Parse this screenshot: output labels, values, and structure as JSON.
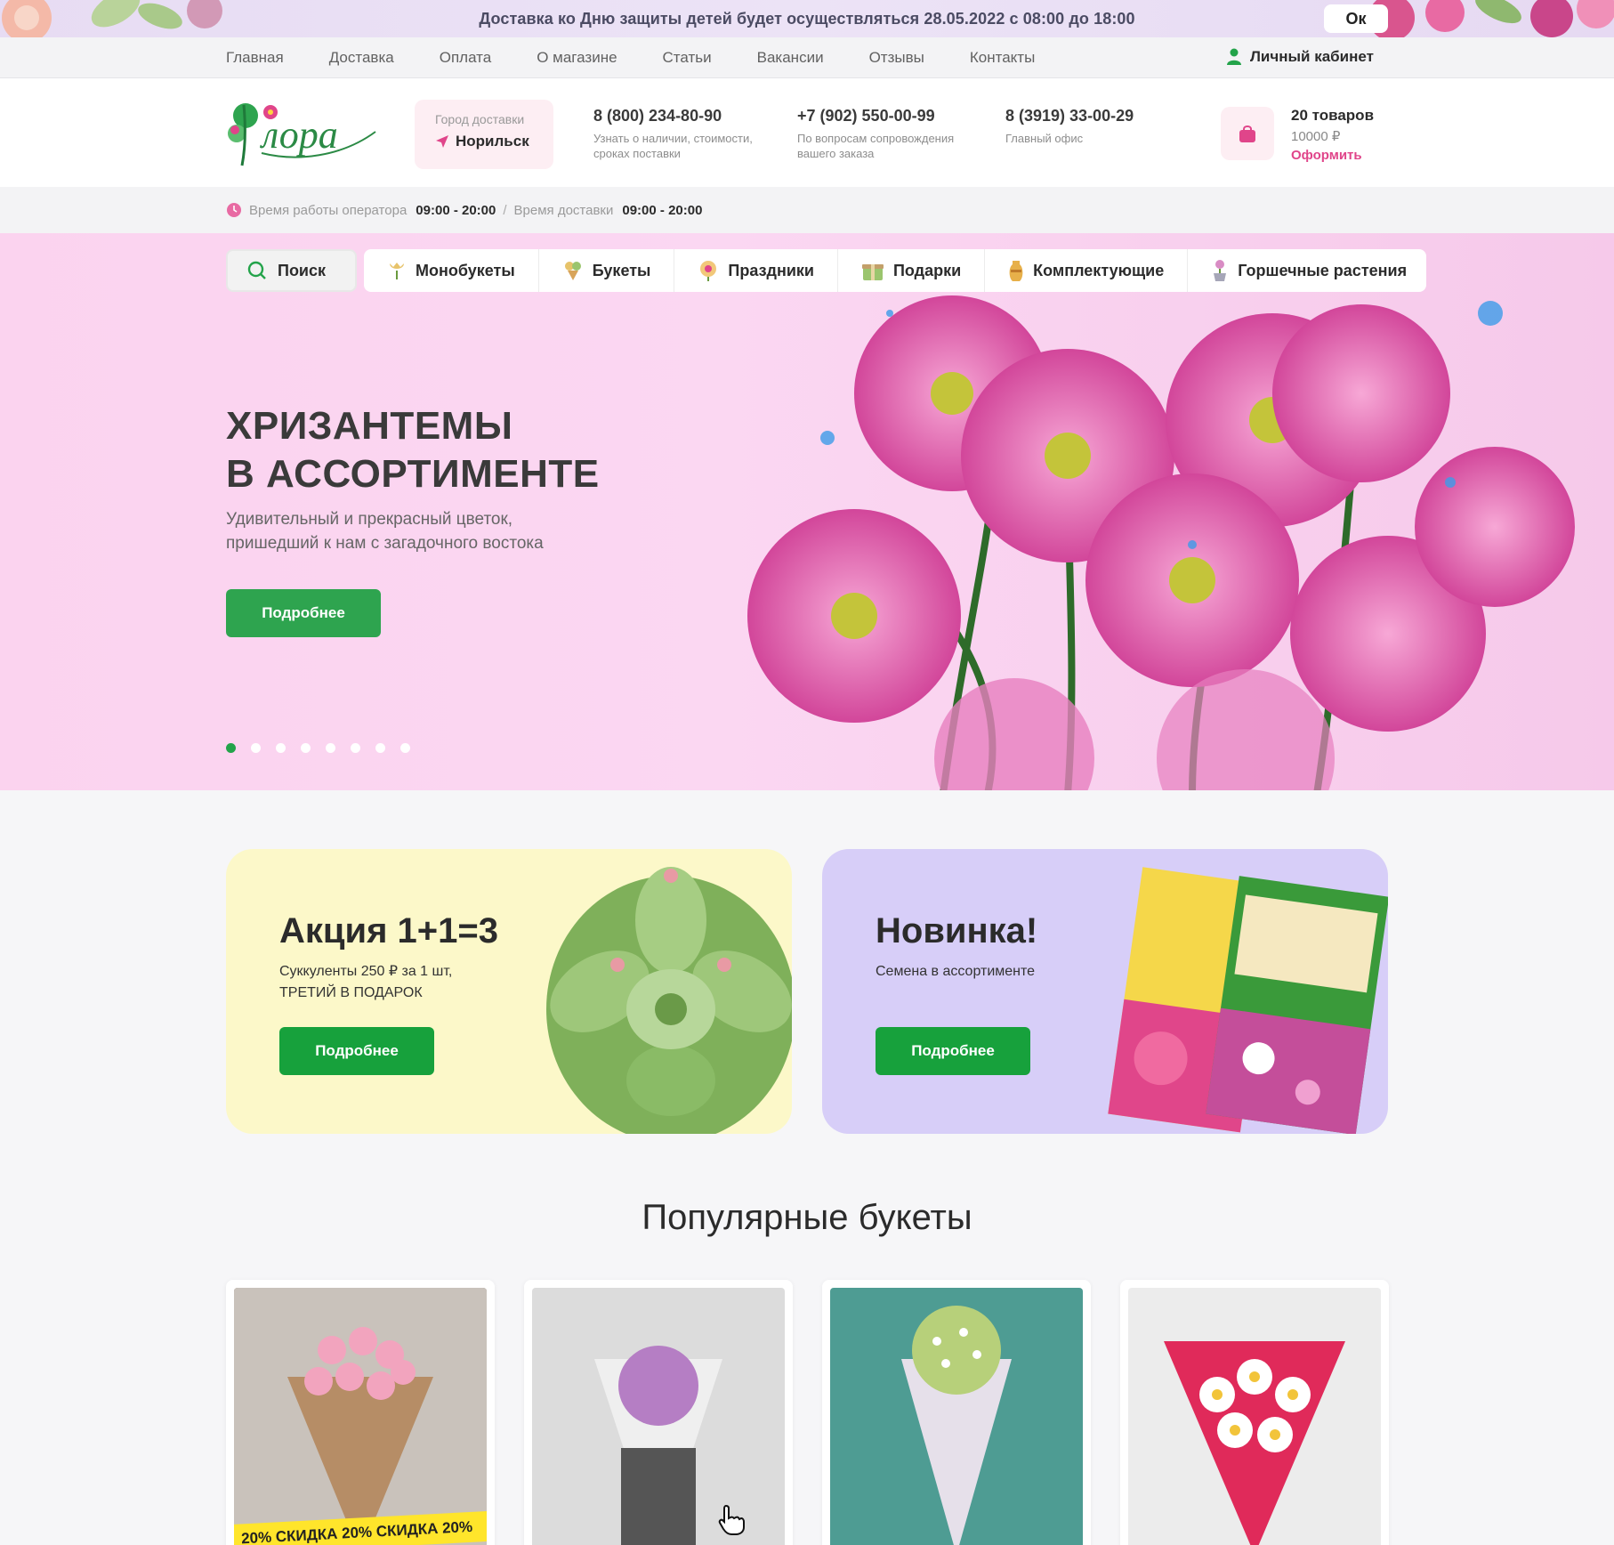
{
  "announcement": {
    "text": "Доставка ко Дню защиты детей будет осуществляться 28.05.2022 с 08:00 до 18:00",
    "ok_label": "Ок"
  },
  "topnav": {
    "items": [
      "Главная",
      "Доставка",
      "Оплата",
      "О магазине",
      "Статьи",
      "Вакансии",
      "Отзывы",
      "Контакты"
    ],
    "cabinet": "Личный кабинет"
  },
  "header": {
    "logo_text": "Флора",
    "city_label": "Город доставки",
    "city_value": "Норильск",
    "phones": [
      {
        "number": "8 (800) 234-80-90",
        "note": "Узнать о наличии, стоимости, сроках поставки"
      },
      {
        "number": "+7 (902) 550-00-99",
        "note": "По вопросам сопровождения вашего заказа"
      },
      {
        "number": "8 (3919) 33-00-29",
        "note": "Главный офис"
      }
    ],
    "cart": {
      "count": "20 товаров",
      "sum": "10000 ₽",
      "checkout": "Оформить"
    }
  },
  "hours": {
    "operator_label": "Время работы оператора",
    "operator_value": "09:00 - 20:00",
    "separator": "/",
    "delivery_label": "Время доставки",
    "delivery_value": "09:00 - 20:00"
  },
  "categories": {
    "search": "Поиск",
    "items": [
      "Монобукеты",
      "Букеты",
      "Праздники",
      "Подарки",
      "Комплектующие",
      "Горшечные растения"
    ]
  },
  "hero": {
    "title_line1": "ХРИЗАНТЕМЫ",
    "title_line2": "В АССОРТИМЕНТЕ",
    "subtitle": "Удивительный и прекрасный цветок, пришедший к нам с загадочного востока",
    "button": "Подробнее",
    "slides_total": 8,
    "active_slide": 1
  },
  "promos": [
    {
      "title": "Акция 1+1=3",
      "text": "Суккуленты 250 ₽ за 1 шт, ТРЕТИЙ В ПОДАРОК",
      "button": "Подробнее",
      "color": "#fcf8c9"
    },
    {
      "title": "Новинка!",
      "text": "Семена в ассортименте",
      "button": "Подробнее",
      "color": "#d7cef8"
    }
  ],
  "popular": {
    "title": "Популярные букеты",
    "sale_ribbon": "20%  СКИДКА   20%  СКИДКА   20%"
  },
  "colors": {
    "accent_green": "#2ea44f",
    "accent_pink": "#e0458a",
    "hero_bg": "#fbd3ef"
  }
}
